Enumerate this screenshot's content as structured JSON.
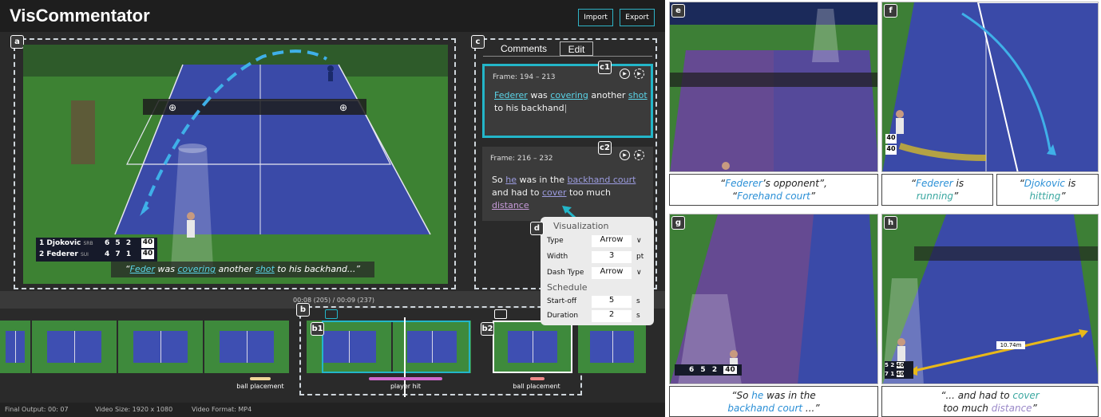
{
  "app": {
    "title": "VisCommentator",
    "import_label": "Import",
    "export_label": "Export"
  },
  "panel_labels": {
    "a": "a",
    "b": "b",
    "b1": "b1",
    "b2": "b2",
    "c": "c",
    "c1": "c1",
    "c2": "c2",
    "d": "d"
  },
  "video": {
    "scoreboard": [
      {
        "rank": "1",
        "name": "Djokovic",
        "country": "SRB",
        "s1": "6",
        "s2": "5",
        "s3": "2",
        "pts": "40"
      },
      {
        "rank": "2",
        "name": "Federer",
        "country": "SUI",
        "s1": "4",
        "s2": "7",
        "s3": "1",
        "pts": "40"
      }
    ],
    "subtitle": {
      "open": "“",
      "w1": "Feder",
      "w2": " was ",
      "w3": "covering",
      "w4": " another ",
      "w5": "shot",
      "w6": " to his backhand...”"
    }
  },
  "comments": {
    "tabs": [
      "Comments",
      "Edit"
    ],
    "c1": {
      "frame": "Frame: 194 – 213",
      "t1": "Federer",
      "t2": " was ",
      "t3": "covering",
      "t4": " another ",
      "t5": "shot",
      "t6": " to his backhand"
    },
    "c2": {
      "frame": "Frame: 216 – 232",
      "t1": "So ",
      "t2": "he",
      "t3": " was in the ",
      "t4": "backhand court",
      "t5": " and had to ",
      "t6": "cover",
      "t7": " too much ",
      "t8": "distance"
    }
  },
  "visualization": {
    "header": "Visualization",
    "rows": [
      {
        "label": "Type",
        "value": "Arrow",
        "unit": "∨"
      },
      {
        "label": "Width",
        "value": "3",
        "unit": "pt"
      },
      {
        "label": "Dash Type",
        "value": "Arrow",
        "unit": "∨"
      }
    ],
    "schedule_header": "Schedule",
    "schedule": [
      {
        "label": "Start-off",
        "value": "5",
        "unit": "s"
      },
      {
        "label": "Duration",
        "value": "2",
        "unit": "s"
      }
    ]
  },
  "timeline": {
    "time": "00:08 (205) / 00:09 (237)",
    "events": [
      "ball placement",
      "player hit",
      "ball placement"
    ]
  },
  "status": {
    "final_output": "Final Output: 00: 07",
    "video_size": "Video Size: 1920 x 1080",
    "video_format": "Video Format: MP4"
  },
  "figures": {
    "e": {
      "label": "e",
      "cap_a": "Federer",
      "cap_b": "’s opponent”,",
      "cap_c": "Forehand court",
      "q": "“"
    },
    "f": {
      "label": "f",
      "cap1_a": "Federer",
      "cap1_b": " is",
      "cap1_c": "running",
      "cap2_a": "Djokovic",
      "cap2_b": " is",
      "cap2_c": "hitting",
      "score": [
        "40",
        "40"
      ]
    },
    "g": {
      "label": "g",
      "cap_a": "“So ",
      "cap_b": "he",
      "cap_c": " was in the",
      "cap_d": "backhand court",
      "cap_e": " ...”",
      "score": [
        "6",
        "5",
        "2",
        "40"
      ]
    },
    "h": {
      "label": "h",
      "cap_a": "“... and had to ",
      "cap_b": "cover",
      "cap_c": "too much ",
      "cap_d": "distance",
      "cap_e": "”",
      "distance": "10.74m",
      "score": [
        "5",
        "2",
        "40",
        "7",
        "1",
        "40"
      ]
    }
  },
  "colors": {
    "accent": "#2fb3c6",
    "court": "#3b4ba8",
    "grass": "#3b7f36",
    "arrow": "#3fb0e8",
    "yellow": "#e8b81a"
  }
}
